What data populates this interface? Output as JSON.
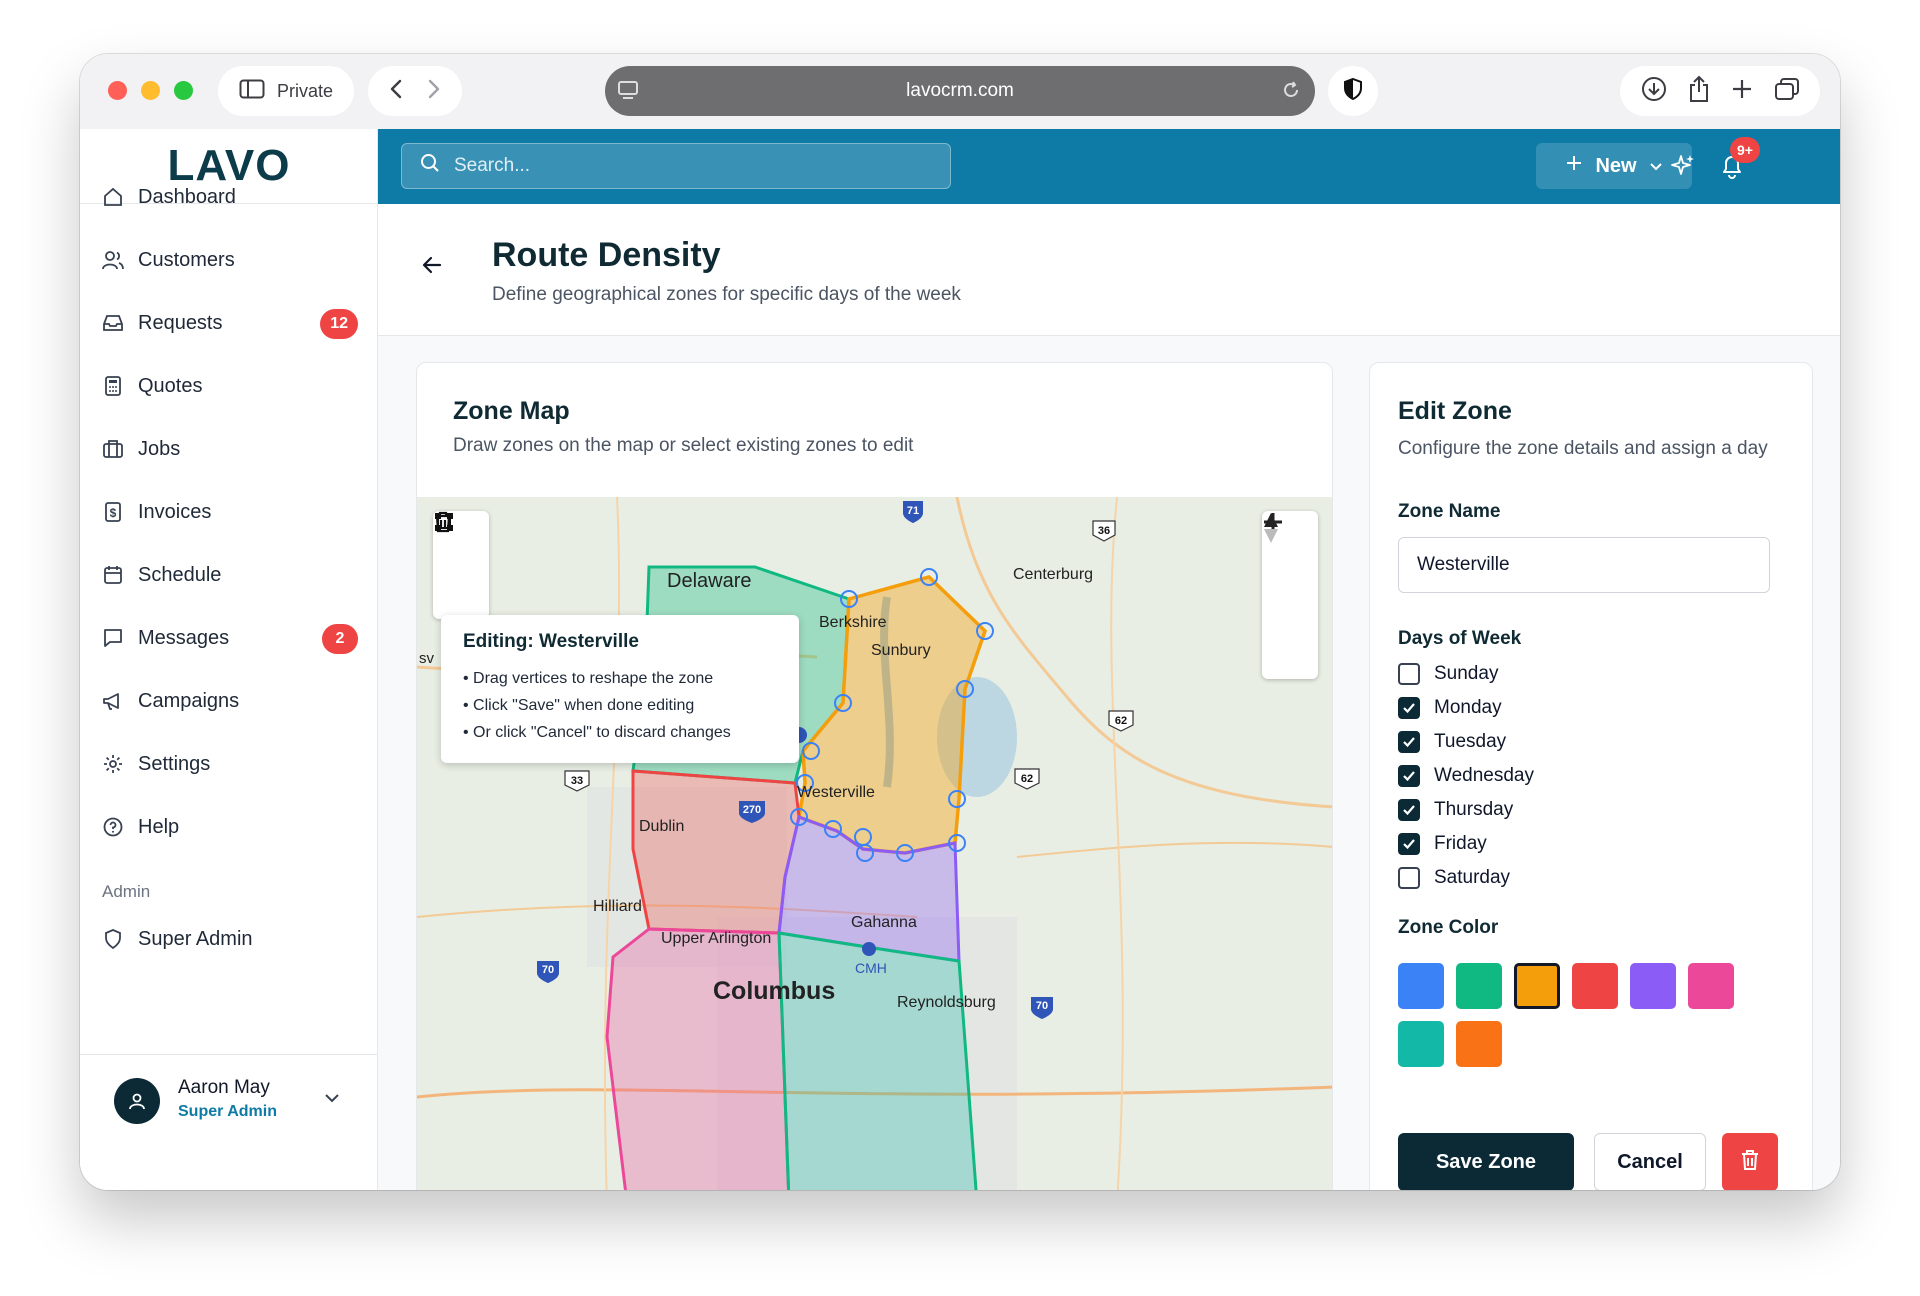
{
  "browser": {
    "private_label": "Private",
    "url": "lavocrm.com"
  },
  "app": {
    "logo": "LAVO"
  },
  "sidebar": {
    "items": [
      {
        "label": "Dashboard",
        "icon": "home-icon"
      },
      {
        "label": "Customers",
        "icon": "users-icon"
      },
      {
        "label": "Requests",
        "icon": "inbox-icon",
        "badge": "12"
      },
      {
        "label": "Quotes",
        "icon": "calculator-icon"
      },
      {
        "label": "Jobs",
        "icon": "briefcase-icon"
      },
      {
        "label": "Invoices",
        "icon": "dollar-file-icon"
      },
      {
        "label": "Schedule",
        "icon": "calendar-icon"
      },
      {
        "label": "Messages",
        "icon": "message-icon",
        "badge": "2"
      },
      {
        "label": "Campaigns",
        "icon": "megaphone-icon"
      },
      {
        "label": "Settings",
        "icon": "gear-icon"
      },
      {
        "label": "Help",
        "icon": "help-circle-icon"
      }
    ],
    "admin_section": "Admin",
    "admin_item": "Super Admin",
    "user_name": "Aaron May",
    "user_role": "Super Admin"
  },
  "topbar": {
    "search_placeholder": "Search...",
    "new_label": "New",
    "notif_count": "9+"
  },
  "page": {
    "title": "Route Density",
    "subtitle": "Define geographical zones for specific days of the week"
  },
  "map_card": {
    "title": "Zone Map",
    "subtitle": "Draw zones on the map or select existing zones to edit",
    "tooltip_title": "Editing: Westerville",
    "tooltip_lines": [
      "• Drag vertices to reshape the zone",
      "• Click \"Save\" when done editing",
      "• Or click \"Cancel\" to discard changes"
    ],
    "places": [
      "Delaware",
      "Berkshire",
      "Sunbury",
      "Centerburg",
      "Westerville",
      "Dublin",
      "Hilliard",
      "Upper Arlington",
      "Gahanna",
      "CMH",
      "Columbus",
      "Reynoldsburg",
      "sv"
    ],
    "shields": [
      "71",
      "36",
      "62",
      "62",
      "33",
      "270",
      "70",
      "70"
    ]
  },
  "edit_card": {
    "title": "Edit Zone",
    "subtitle": "Configure the zone details and assign a day",
    "zone_name_label": "Zone Name",
    "zone_name_value": "Westerville",
    "days_label": "Days of Week",
    "days": [
      {
        "label": "Sunday",
        "checked": false
      },
      {
        "label": "Monday",
        "checked": true
      },
      {
        "label": "Tuesday",
        "checked": true
      },
      {
        "label": "Wednesday",
        "checked": true
      },
      {
        "label": "Thursday",
        "checked": true
      },
      {
        "label": "Friday",
        "checked": true
      },
      {
        "label": "Saturday",
        "checked": false
      }
    ],
    "color_label": "Zone Color",
    "colors": [
      "#3b82f6",
      "#10b981",
      "#f59e0b",
      "#ef4444",
      "#8b5cf6",
      "#ec4899",
      "#14b8a6",
      "#f97316"
    ],
    "selected_color": "#f59e0b",
    "save_label": "Save Zone",
    "cancel_label": "Cancel"
  }
}
